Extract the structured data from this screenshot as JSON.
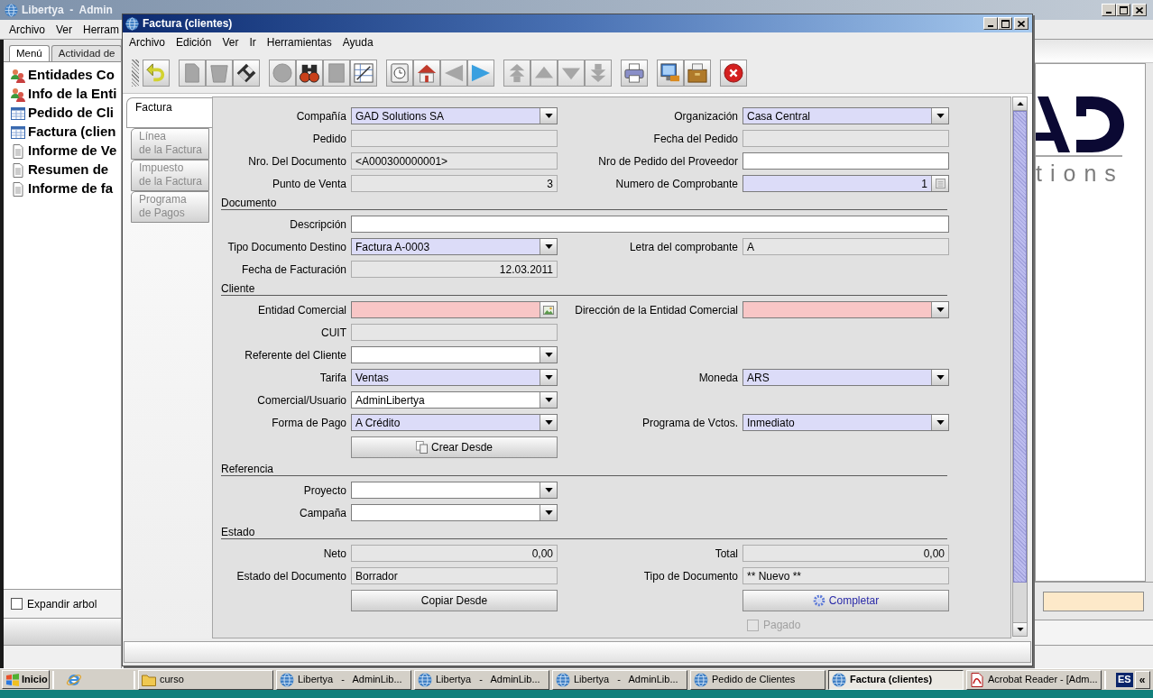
{
  "background_window": {
    "title": "Libertya  -  Admin",
    "menu": [
      "Archivo",
      "Ver",
      "Herram"
    ],
    "tabs": [
      {
        "label": "Menú",
        "selected": true
      },
      {
        "label": "Actividad de",
        "selected": false
      }
    ],
    "tree": [
      {
        "label": "Entidades Co",
        "kind": "people"
      },
      {
        "label": "Info de la Enti",
        "kind": "people"
      },
      {
        "label": "Pedido de Cli",
        "kind": "window"
      },
      {
        "label": "Factura (clien",
        "kind": "window"
      },
      {
        "label": "Informe de Ve",
        "kind": "report"
      },
      {
        "label": "Resumen de",
        "kind": "report"
      },
      {
        "label": "Informe de fa",
        "kind": "report"
      }
    ],
    "expand_tree": {
      "label": "Expandir arbol",
      "checked": false
    },
    "logo": {
      "tagline": "tions"
    }
  },
  "window": {
    "title": "Factura (clientes)",
    "menu": [
      "Archivo",
      "Edición",
      "Ver",
      "Ir",
      "Herramientas",
      "Ayuda"
    ],
    "toolbar": [
      [
        {
          "kind": "undo",
          "disabled": false
        }
      ],
      [
        {
          "kind": "new",
          "disabled": true
        },
        {
          "kind": "delete",
          "disabled": true
        },
        {
          "kind": "save",
          "disabled": false
        }
      ],
      [
        {
          "kind": "refresh",
          "disabled": true
        },
        {
          "kind": "find",
          "disabled": false
        },
        {
          "kind": "attachment",
          "disabled": true
        },
        {
          "kind": "grid",
          "disabled": false
        }
      ],
      [
        {
          "kind": "history",
          "disabled": false
        },
        {
          "kind": "home",
          "disabled": false
        },
        {
          "kind": "back",
          "disabled": true
        },
        {
          "kind": "forward",
          "disabled": false
        }
      ],
      [
        {
          "kind": "first",
          "disabled": true
        },
        {
          "kind": "previous",
          "disabled": true
        },
        {
          "kind": "next",
          "disabled": true
        },
        {
          "kind": "last",
          "disabled": true
        }
      ],
      [
        {
          "kind": "print",
          "disabled": false
        }
      ],
      [
        {
          "kind": "report",
          "disabled": false
        },
        {
          "kind": "archive",
          "disabled": false
        }
      ],
      [
        {
          "kind": "exit",
          "disabled": false
        }
      ]
    ],
    "tabs": [
      {
        "label": "Factura",
        "selected": true
      },
      {
        "label": "Línea\nde la Factura",
        "selected": false
      },
      {
        "label": "Impuesto\nde la Factura",
        "selected": false
      },
      {
        "label": "Programa\nde Pagos",
        "selected": false
      }
    ],
    "sections": [
      {
        "rows": [
          {
            "left": {
              "label": "Compañía",
              "kind": "combo",
              "value": "GAD Solutions SA",
              "mandatory": true,
              "read_only": false,
              "invalid": false
            },
            "right": {
              "label": "Organización",
              "kind": "combo",
              "value": "Casa Central",
              "mandatory": true,
              "read_only": false,
              "invalid": false
            }
          },
          {
            "left": {
              "label": "Pedido",
              "kind": "text",
              "mandatory": false,
              "read_only": true,
              "invalid": false
            },
            "right": {
              "label": "Fecha del Pedido",
              "kind": "text",
              "mandatory": false,
              "read_only": true,
              "invalid": false
            }
          },
          {
            "left": {
              "label": "Nro. Del Documento",
              "kind": "text",
              "value": "<A000300000001>",
              "mandatory": false,
              "read_only": true,
              "invalid": false
            },
            "right": {
              "label": "Nro de Pedido del Proveedor",
              "kind": "text",
              "mandatory": false,
              "read_only": false,
              "invalid": false
            }
          },
          {
            "left": {
              "label": "Punto de Venta",
              "kind": "number",
              "value": "3",
              "mandatory": false,
              "read_only": true,
              "invalid": false
            },
            "right": {
              "label": "Numero de Comprobante",
              "kind": "calculator",
              "value": "1",
              "mandatory": true,
              "read_only": false,
              "invalid": false
            }
          }
        ]
      },
      {
        "title": "Documento",
        "rows": [
          {
            "full": {
              "label": "Descripción",
              "kind": "text",
              "mandatory": false,
              "read_only": false,
              "invalid": false
            }
          },
          {
            "left": {
              "label": "Tipo Documento Destino",
              "kind": "combo",
              "value": "Factura A-0003",
              "mandatory": true,
              "read_only": false,
              "invalid": false
            },
            "right": {
              "label": "Letra del comprobante",
              "kind": "text",
              "value": "A",
              "mandatory": false,
              "read_only": true,
              "invalid": false
            }
          },
          {
            "left": {
              "label": "Fecha de Facturación",
              "kind": "date",
              "value": "12.03.2011",
              "mandatory": false,
              "read_only": true,
              "invalid": false
            }
          }
        ]
      },
      {
        "title": "Cliente",
        "rows": [
          {
            "left": {
              "label": "Entidad Comercial",
              "kind": "search",
              "mandatory": true,
              "read_only": false,
              "invalid": true
            },
            "right": {
              "label": "Dirección de la Entidad Comercial",
              "kind": "combo",
              "mandatory": true,
              "read_only": false,
              "invalid": true
            }
          },
          {
            "left": {
              "label": "CUIT",
              "kind": "text",
              "mandatory": false,
              "read_only": true,
              "invalid": false
            }
          },
          {
            "left": {
              "label": "Referente del Cliente",
              "kind": "combo",
              "mandatory": false,
              "read_only": false,
              "invalid": false
            }
          },
          {
            "left": {
              "label": "Tarifa",
              "kind": "combo",
              "value": "Ventas",
              "mandatory": true,
              "read_only": false,
              "invalid": false
            },
            "right": {
              "label": "Moneda",
              "kind": "combo",
              "value": "ARS",
              "mandatory": true,
              "read_only": false,
              "invalid": false
            }
          },
          {
            "left": {
              "label": "Comercial/Usuario",
              "kind": "combo",
              "value": "AdminLibertya",
              "mandatory": false,
              "read_only": false,
              "invalid": false
            }
          },
          {
            "left": {
              "label": "Forma de Pago",
              "kind": "combo",
              "value": "A Crédito",
              "mandatory": true,
              "read_only": false,
              "invalid": false
            },
            "right": {
              "label": "Programa de Vctos.",
              "kind": "combo",
              "value": "Inmediato",
              "mandatory": true,
              "read_only": false,
              "invalid": false
            }
          },
          {
            "left": {
              "label": "Crear Desde",
              "kind": "create"
            }
          }
        ]
      },
      {
        "title": "Referencia",
        "rows": [
          {
            "left": {
              "label": "Proyecto",
              "kind": "combo",
              "mandatory": false,
              "read_only": false,
              "invalid": false
            }
          },
          {
            "left": {
              "label": "Campaña",
              "kind": "combo",
              "mandatory": false,
              "read_only": false,
              "invalid": false
            }
          }
        ]
      },
      {
        "title": "Estado",
        "rows": [
          {
            "left": {
              "label": "Neto",
              "kind": "number",
              "value": "0,00",
              "mandatory": false,
              "read_only": true,
              "invalid": false
            },
            "right": {
              "label": "Total",
              "kind": "number",
              "value": "0,00",
              "mandatory": false,
              "read_only": true,
              "invalid": false
            }
          },
          {
            "left": {
              "label": "Estado del Documento",
              "kind": "text",
              "value": "Borrador",
              "mandatory": false,
              "read_only": true,
              "invalid": false
            },
            "right": {
              "label": "Tipo de Documento",
              "kind": "text",
              "value": "** Nuevo **",
              "mandatory": false,
              "read_only": true,
              "invalid": false
            }
          },
          {
            "left": {
              "label": "Copiar Desde",
              "kind": "copy"
            },
            "right": {
              "label": "Completar",
              "kind": "process"
            }
          },
          {
            "right": {
              "label": "Pagado",
              "kind": "checkbox",
              "checked": false,
              "disabled": true
            }
          }
        ]
      }
    ]
  },
  "taskbar": {
    "start": "Inicio",
    "items": [
      {
        "label": "curso",
        "kind": "folder",
        "selected": false
      },
      {
        "label": "Libertya   -   AdminLib...",
        "kind": "app",
        "selected": false
      },
      {
        "label": "Libertya   -   AdminLib...",
        "kind": "app",
        "selected": false
      },
      {
        "label": "Libertya   -   AdminLib...",
        "kind": "app",
        "selected": false
      },
      {
        "label": "Pedido de Clientes",
        "kind": "app",
        "selected": false
      },
      {
        "label": "Factura (clientes)",
        "kind": "app",
        "selected": true
      },
      {
        "label": "Acrobat Reader - [Adm...",
        "kind": "pdf",
        "selected": false
      }
    ],
    "language": "ES",
    "more": "«"
  }
}
